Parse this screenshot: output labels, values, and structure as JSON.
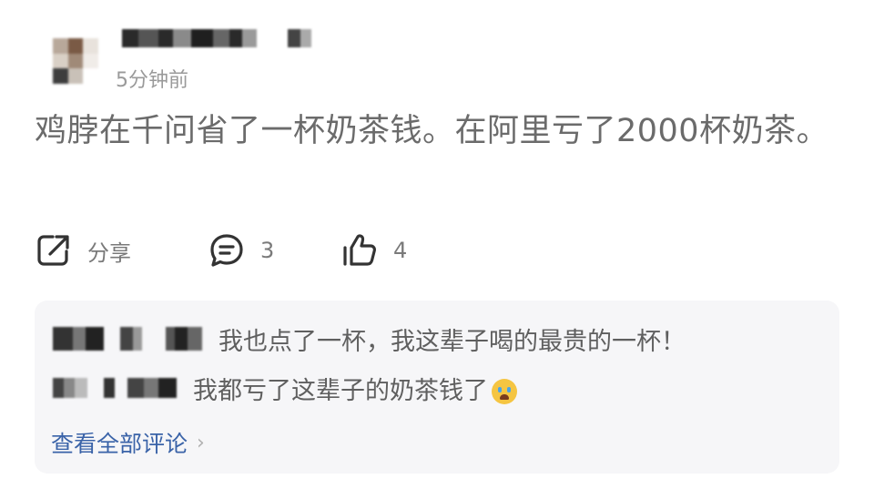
{
  "post": {
    "time_ago": "5分钟前",
    "content": "鸡脖在千问省了一杯奶茶钱。在阿里亏了2000杯奶茶。",
    "actions": {
      "share_label": "分享",
      "comment_count": "3",
      "like_count": "4"
    }
  },
  "comments": {
    "items": [
      {
        "text": "我也点了一杯，我这辈子喝的最贵的一杯！"
      },
      {
        "text": "我都亏了这辈子的奶茶钱了"
      }
    ],
    "view_all_label": "查看全部评论",
    "view_all_chevron": "›"
  },
  "icons": {
    "share": "share-icon",
    "comment": "comment-icon",
    "like": "thumbs-up-icon",
    "emoji": "crying-face-emoji"
  },
  "colors": {
    "link": "#3a63a8",
    "panel_bg": "#f6f6f8",
    "muted_text": "#9a9a9a"
  }
}
